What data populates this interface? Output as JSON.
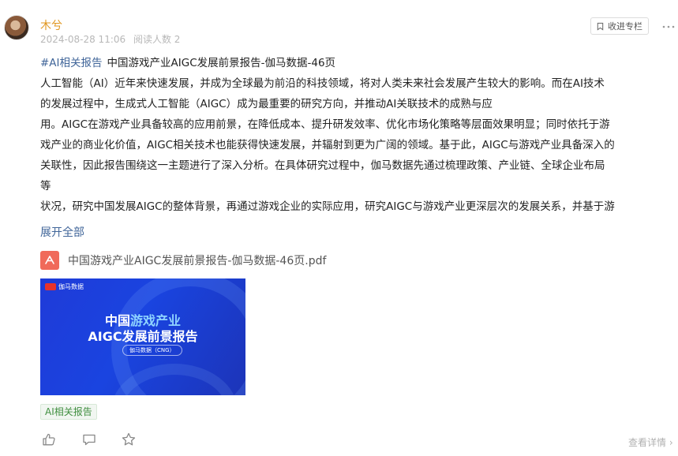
{
  "post": {
    "author": "木兮",
    "timestamp": "2024-08-28 11:06",
    "read_count": "阅读人数 2",
    "fav_label": "收进专栏",
    "hashtag": "#AI相关报告",
    "title": "中国游戏产业AIGC发展前景报告-伽马数据-46页",
    "lines": [
      "人工智能（AI）近年来快速发展，并成为全球最为前沿的科技领域，将对人类未来社会发展产生较大的影响。而在AI技术",
      "的发展过程中，生成式人工智能（AIGC）成为最重要的研究方向，并推动AI关联技术的成熟与应",
      "用。AIGC在游戏产业具备较高的应用前景，在降低成本、提升研发效率、优化市场化策略等层面效果明显；同时依托于游",
      "戏产业的商业化价值，AIGC相关技术也能获得快速发展，并辐射到更为广阔的领域。基于此，AIGC与游戏产业具备深入的",
      "关联性，因此报告围绕这一主题进行了深入分析。在具体研究过程中，伽马数据先通过梳理政策、产业链、全球企业布局",
      "等",
      "状况，研究中国发展AIGC的整体背景，再通过游戏企业的实际应用，研究AIGC与游戏产业更深层次的发展关系，并基于游"
    ],
    "expand_label": "展开全部",
    "attachment_name": "中国游戏产业AIGC发展前景报告-伽马数据-46页.pdf",
    "thumbnail": {
      "logo_text": "伽马数据",
      "title_prefix": "中国",
      "title_highlight": "游戏产业",
      "title_line2": "AIGC发展前景报告",
      "pill_text": "伽马数据（CNG）"
    },
    "tag": "AI相关报告",
    "details_label": "查看详情 ›"
  },
  "colors": {
    "author": "#e0961e",
    "link": "#406599",
    "tag_green": "#3f8f3f",
    "pdf_red": "#f06a5a",
    "thumb_blue": "#1a44e0"
  },
  "icons": {
    "fav": "bookmark-icon",
    "more": "more-dots-icon",
    "pdf": "pdf-file-icon",
    "like": "thumbs-up-icon",
    "comment": "comment-icon",
    "star": "star-icon"
  }
}
